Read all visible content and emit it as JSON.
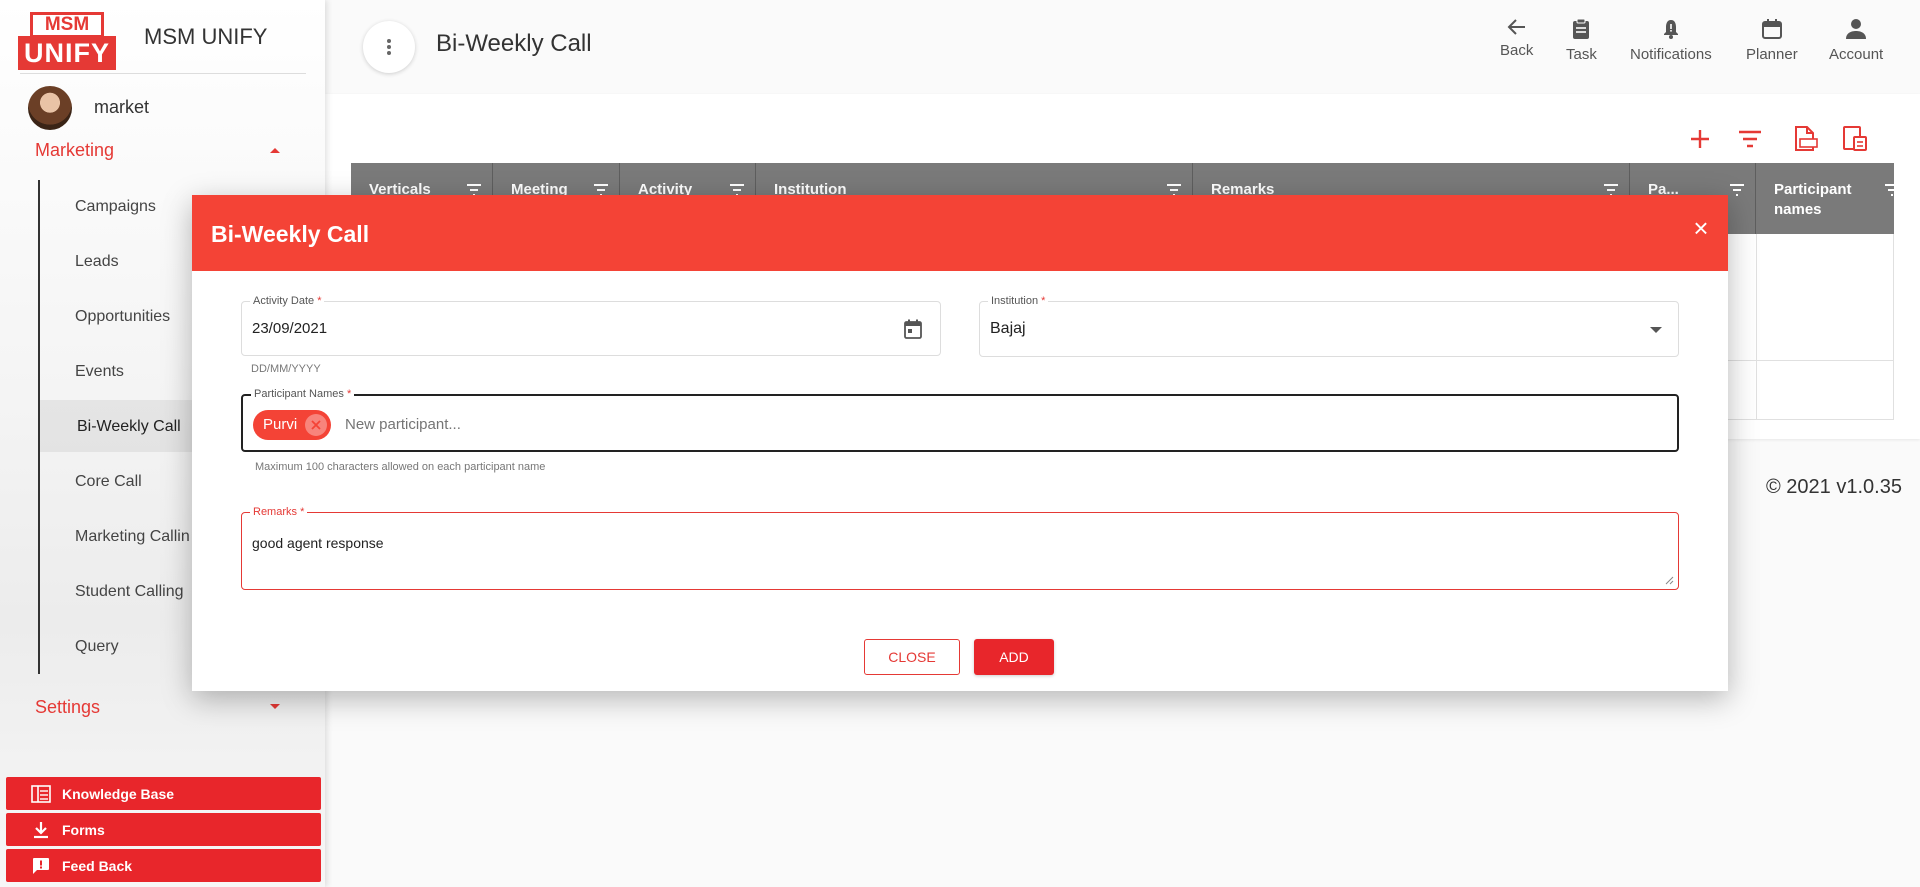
{
  "sidebar": {
    "logo": {
      "top": "MSM",
      "bottom": "UNIFY"
    },
    "app_title": "MSM UNIFY",
    "user_name": "market",
    "marketing_label": "Marketing",
    "items": [
      {
        "label": "Campaigns"
      },
      {
        "label": "Leads"
      },
      {
        "label": "Opportunities"
      },
      {
        "label": "Events"
      },
      {
        "label": "Bi-Weekly Call",
        "active": true
      },
      {
        "label": "Core Call"
      },
      {
        "label": "Marketing Callin"
      },
      {
        "label": "Student Calling"
      },
      {
        "label": "Query"
      }
    ],
    "settings_label": "Settings",
    "bottom_buttons": [
      {
        "label": "Knowledge Base",
        "icon": "knowledge-base-icon"
      },
      {
        "label": "Forms",
        "icon": "download-icon"
      },
      {
        "label": "Feed Back",
        "icon": "feedback-icon"
      }
    ]
  },
  "header": {
    "title": "Bi-Weekly Call",
    "actions": [
      {
        "label": "Back",
        "icon": "arrow-back-icon"
      },
      {
        "label": "Task",
        "icon": "clipboard-icon"
      },
      {
        "label": "Notifications",
        "icon": "bell-icon"
      },
      {
        "label": "Planner",
        "icon": "calendar-icon"
      },
      {
        "label": "Account",
        "icon": "person-icon"
      }
    ]
  },
  "table": {
    "columns": [
      {
        "label": "Verticals"
      },
      {
        "label": "Meeting"
      },
      {
        "label": "Activity Date"
      },
      {
        "label": "Institution"
      },
      {
        "label": "Remarks"
      },
      {
        "label": "Pa..."
      },
      {
        "label": "Participant names"
      }
    ]
  },
  "footer": {
    "version": "© 2021 v1.0.35"
  },
  "modal": {
    "title": "Bi-Weekly Call",
    "activity_date": {
      "label": "Activity Date",
      "value": "23/09/2021",
      "hint": "DD/MM/YYYY"
    },
    "institution": {
      "label": "Institution",
      "value": "Bajaj"
    },
    "participants": {
      "label": "Participant Names",
      "chips": [
        "Purvi"
      ],
      "placeholder": "New participant...",
      "hint": "Maximum 100 characters allowed on each participant name"
    },
    "remarks": {
      "label": "Remarks",
      "value": "good agent response"
    },
    "close_label": "CLOSE",
    "add_label": "ADD"
  },
  "colors": {
    "accent": "#f44336",
    "button": "#e8262b",
    "table_header": "#7a7a7a"
  }
}
